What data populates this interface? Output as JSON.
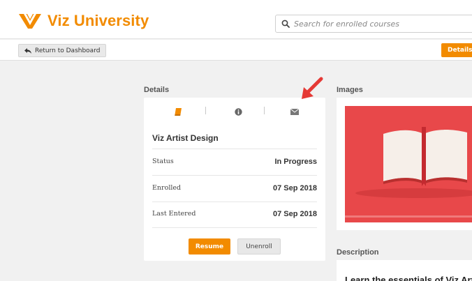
{
  "header": {
    "brand": "Viz University",
    "brand_color": "#f28b00",
    "search": {
      "placeholder": "Search for enrolled courses",
      "value": "",
      "icon": "search-icon"
    }
  },
  "subbar": {
    "back_label": "Return to Dashboard",
    "back_icon": "reply-arrow-icon",
    "details_label": "Details"
  },
  "details": {
    "section_label": "Details",
    "tabs": [
      {
        "icon": "book-icon",
        "active": true
      },
      {
        "icon": "info-icon",
        "active": false
      },
      {
        "icon": "envelope-icon",
        "active": false
      }
    ],
    "course_title": "Viz Artist Design",
    "rows": [
      {
        "label": "Status",
        "value": "In Progress"
      },
      {
        "label": "Enrolled",
        "value": "07 Sep 2018"
      },
      {
        "label": "Last Entered",
        "value": "07 Sep 2018"
      }
    ],
    "resume_label": "Resume",
    "unenroll_label": "Unenroll"
  },
  "images": {
    "section_label": "Images",
    "image_icon": "open-book-illustration",
    "background_color": "#e8484a"
  },
  "description": {
    "section_label": "Description",
    "text": "Learn the essentials of Viz Artist"
  },
  "annotation": {
    "icon": "red-arrow-icon",
    "color": "#e53935"
  }
}
